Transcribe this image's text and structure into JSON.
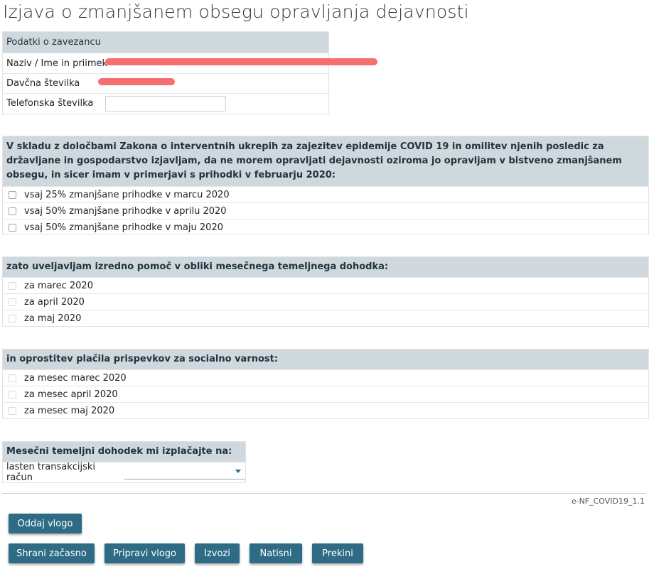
{
  "page": {
    "title": "Izjava o zmanjšanem obsegu opravljanja dejavnosti"
  },
  "taxpayer": {
    "header": "Podatki o zavezancu",
    "name_label": "Naziv / Ime in priimek",
    "tax_label": "Davčna številka",
    "phone_label": "Telefonska številka",
    "phone_value": ""
  },
  "declaration": {
    "text": "V skladu z določbami Zakona o interventnih ukrepih za zajezitev epidemije COVID 19 in omilitev njenih posledic za državljane in gospodarstvo izjavljam, da ne morem opravljati dejavnosti oziroma jo opravljam v bistveno zmanjšanem obsegu, in sicer imam v primerjavi s prihodki v februarju 2020:",
    "options": [
      "vsaj 25% zmanjšane prihodke v marcu 2020",
      "vsaj 50% zmanjšane prihodke v aprilu 2020",
      "vsaj 50% zmanjšane prihodke v maju 2020"
    ]
  },
  "income": {
    "header": "zato uveljavljam izredno pomoč v obliki mesečnega temeljnega dohodka:",
    "options": [
      "za marec 2020",
      "za april 2020",
      "za maj 2020"
    ]
  },
  "contributions": {
    "header": "in oprostitev plačila prispevkov za socialno varnost:",
    "options": [
      "za mesec marec 2020",
      "za mesec april 2020",
      "za mesec maj 2020"
    ]
  },
  "payment": {
    "header": "Mesečni temeljni dohodek mi izplačajte na:",
    "label": "lasten transakcijski račun",
    "selected": ""
  },
  "footer": {
    "code": "e-NF_COVID19_1.1"
  },
  "buttons": {
    "submit": "Oddaj vlogo",
    "save": "Shrani začasno",
    "prepare": "Pripravi vlogo",
    "export": "Izvozi",
    "print": "Natisni",
    "cancel": "Prekini"
  },
  "colors": {
    "accent": "#2e6b85",
    "header_bg": "#cfd8dc",
    "redaction": "#f76e6e"
  }
}
